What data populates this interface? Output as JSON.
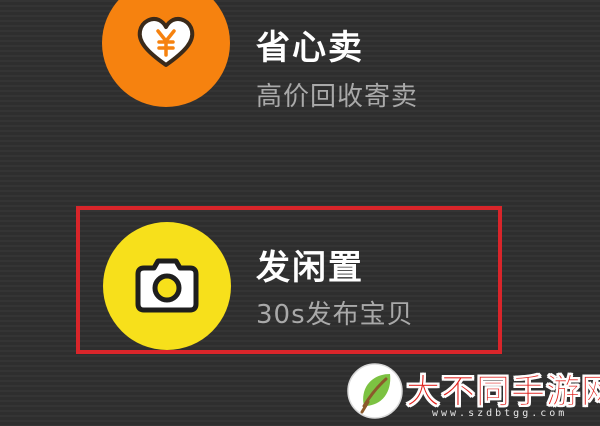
{
  "menu": {
    "items": [
      {
        "title": "省心卖",
        "subtitle": "高价回收寄卖",
        "icon": "heart-yen-icon",
        "color": "#f6820f"
      },
      {
        "title": "发闲置",
        "subtitle": "30s发布宝贝",
        "icon": "camera-icon",
        "color": "#f7e01b"
      }
    ]
  },
  "highlight": {
    "color": "#d9252a"
  },
  "watermark": {
    "title": "大不同手游网",
    "url": "www.szdbtgg.com"
  }
}
